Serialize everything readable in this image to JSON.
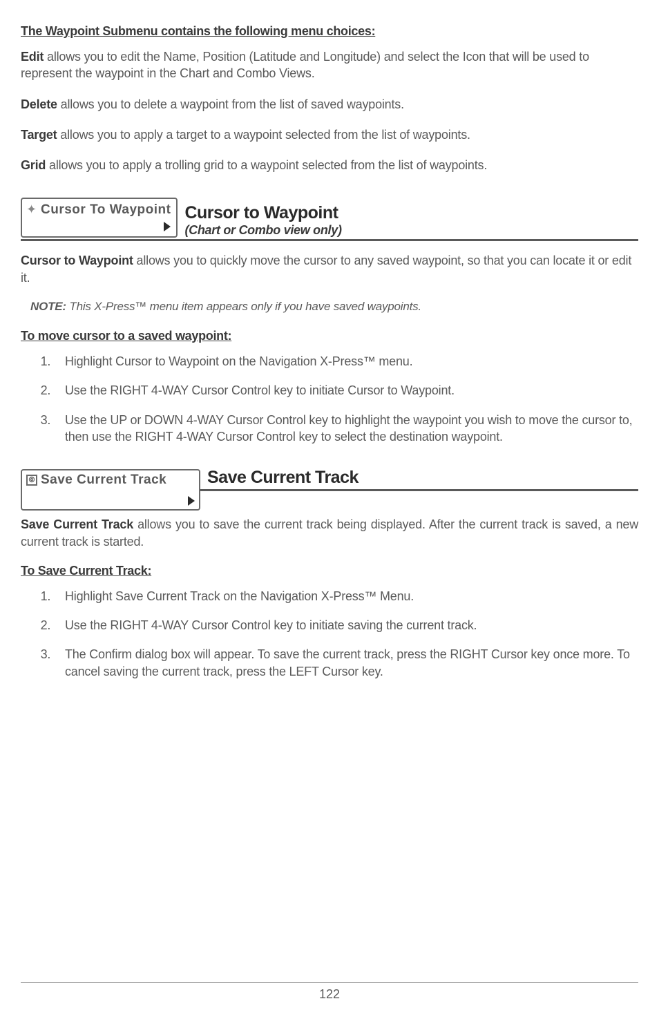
{
  "intro": {
    "heading": "The Waypoint Submenu contains the following menu choices:",
    "edit_label": "Edit",
    "edit_text": " allows you to edit the Name, Position (Latitude and Longitude) and select the Icon that will be used to represent the waypoint in the Chart and Combo Views.",
    "delete_label": "Delete",
    "delete_text": " allows you to delete a waypoint from the list of saved waypoints.",
    "target_label": "Target",
    "target_text": " allows you to apply a target to a waypoint selected from the list of waypoints.",
    "grid_label": "Grid",
    "grid_text": " allows you to apply a trolling grid to a waypoint selected from the list of waypoints."
  },
  "section1": {
    "button_text": "Cursor To Waypoint",
    "title": "Cursor to Waypoint",
    "subtitle": "(Chart or Combo view only)",
    "desc_lead": "Cursor to Waypoint",
    "desc_text": " allows you to quickly move the cursor to any saved waypoint, so that you can locate it or edit it.",
    "note_label": "NOTE:",
    "note_text": " This X-Press™ menu item appears only if you have saved waypoints.",
    "steps_heading": "To move cursor to a saved waypoint:",
    "steps": [
      "Highlight Cursor to Waypoint on the Navigation X-Press™ menu.",
      "Use the RIGHT 4-WAY Cursor Control key to initiate Cursor to Waypoint.",
      "Use the UP or DOWN 4-WAY Cursor Control key to highlight the waypoint you wish to move the cursor to, then use the RIGHT 4-WAY Cursor Control key to select the destination waypoint."
    ]
  },
  "section2": {
    "button_text": "Save Current Track",
    "title": "Save Current Track",
    "desc_lead": "Save Current Track",
    "desc_text": " allows you to save the current track being displayed. After the current track is saved, a new current track is started.",
    "steps_heading": "To Save Current Track:",
    "steps": [
      "Highlight Save Current Track on the Navigation X-Press™ Menu.",
      "Use the RIGHT 4-WAY Cursor Control key to initiate saving the current track.",
      "The Confirm dialog box will appear. To save the current track, press the RIGHT Cursor key once more. To cancel saving the current track, press the LEFT Cursor key."
    ]
  },
  "page_number": "122"
}
